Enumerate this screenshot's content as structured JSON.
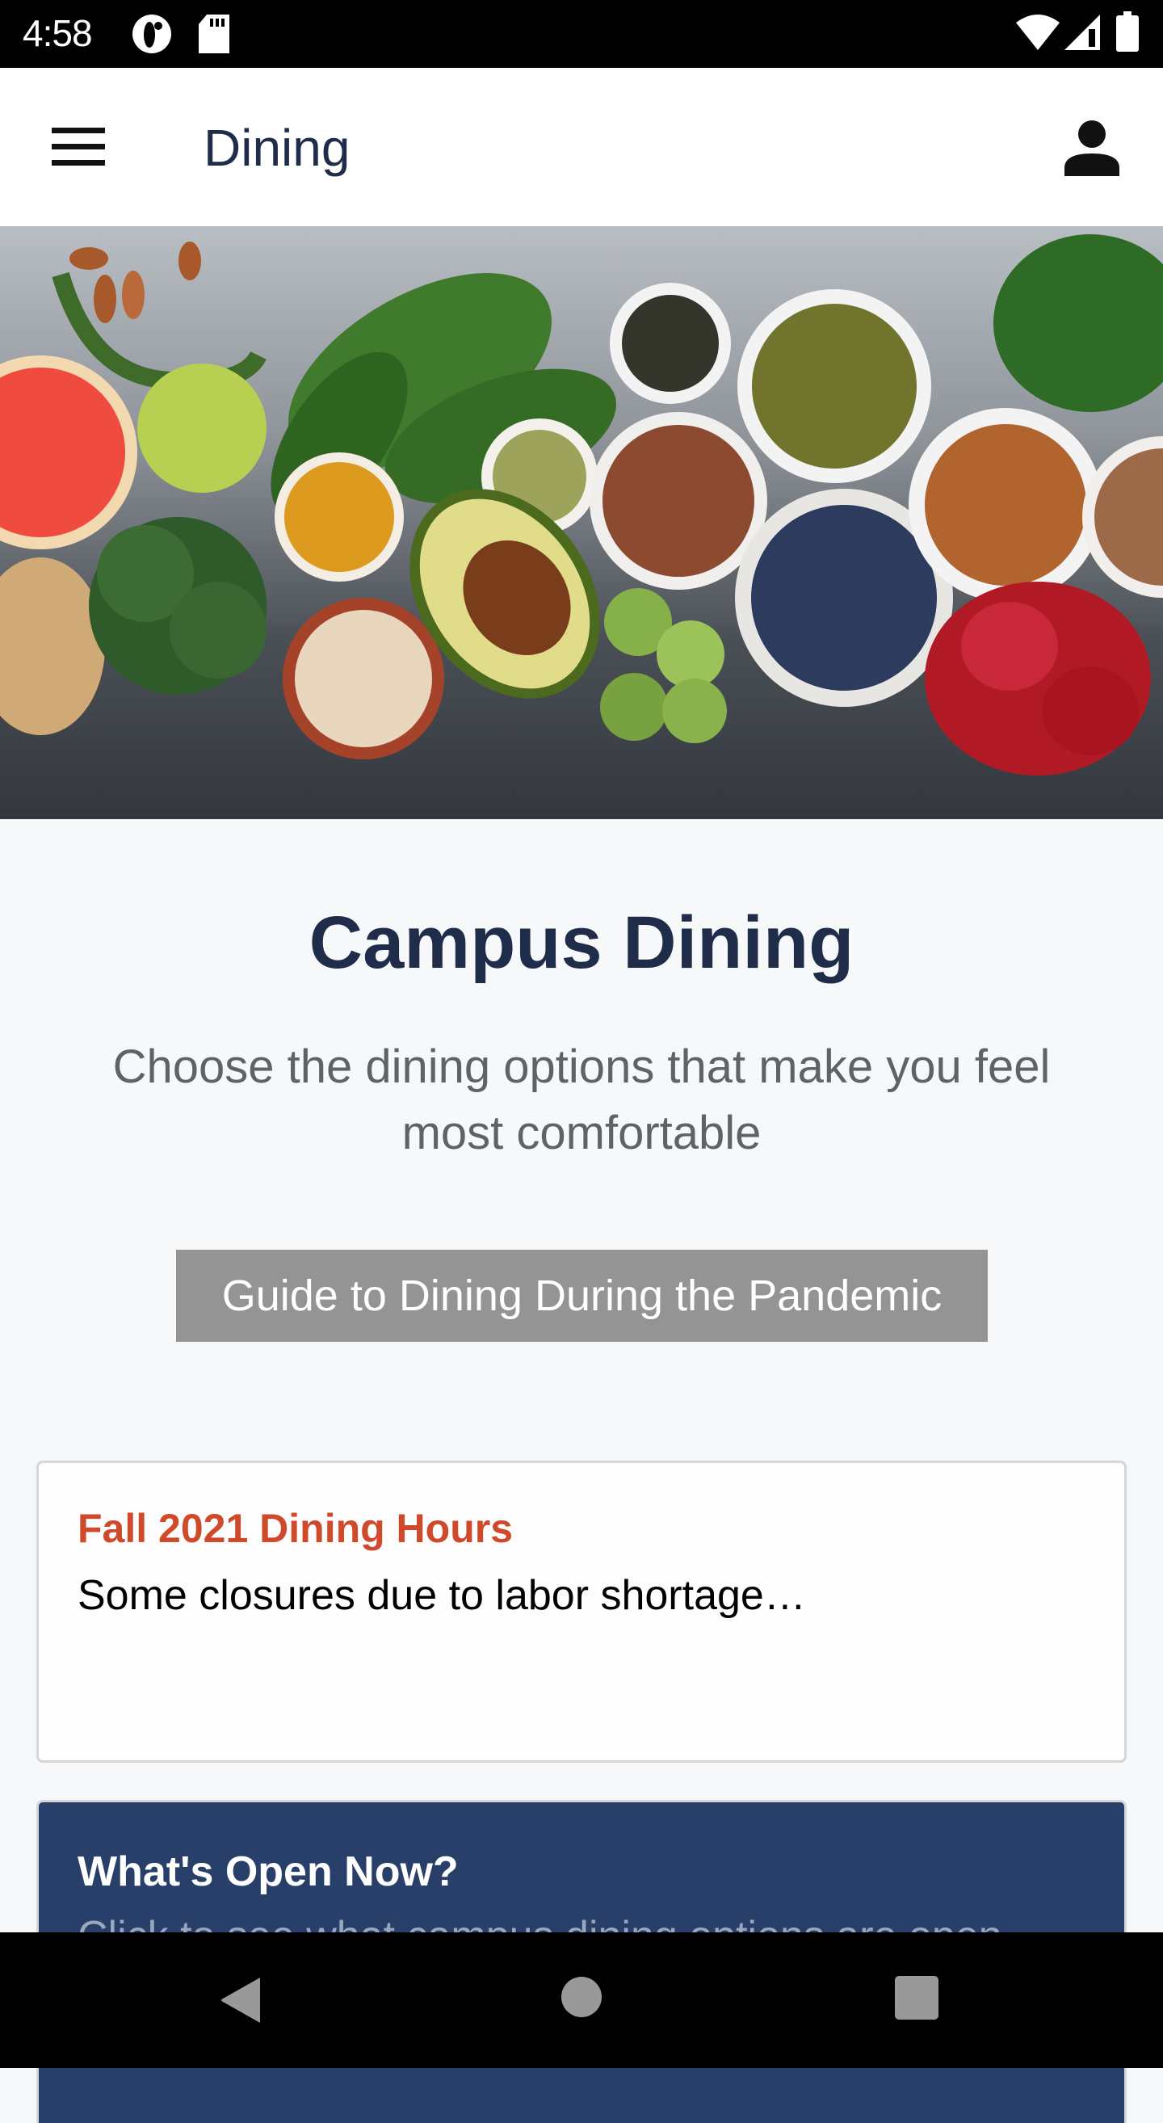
{
  "status_bar": {
    "time": "4:58",
    "left_icons": [
      "data-saver-icon",
      "sd-card-icon"
    ],
    "right_icons": [
      "wifi-icon",
      "cell-signal-icon",
      "battery-icon"
    ]
  },
  "app_bar": {
    "title": "Dining",
    "menu_icon": "hamburger-menu-icon",
    "account_icon": "account-icon"
  },
  "hero": {
    "description": "Healthy food assortment: grapefruit, apple, spinach, broccoli, avocado, blueberries, almonds, pomegranate, grains in bowls"
  },
  "main": {
    "headline": "Campus Dining",
    "subtitle": "Choose the dining options that make you feel most comfortable",
    "guide_button_label": "Guide to Dining During the Pandemic"
  },
  "cards": [
    {
      "title": "Fall 2021 Dining Hours",
      "body": "Some closures due to labor shortage…",
      "title_color": "#cf4a2b"
    },
    {
      "title": "What's Open Now?",
      "body": "Click to see what campus dining options are open",
      "background_color": "#283f69"
    }
  ],
  "nav_bar": {
    "buttons": [
      "back-icon",
      "home-icon",
      "recents-icon"
    ]
  },
  "colors": {
    "brand_navy": "#1f2d4b",
    "accent_orange": "#cf4a2b",
    "button_gray": "#949494",
    "card_navy": "#283f69"
  }
}
